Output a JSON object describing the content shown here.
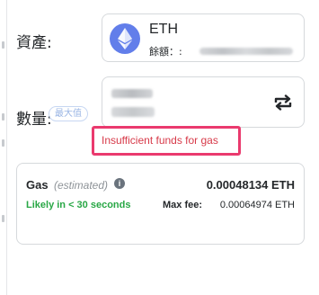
{
  "asset": {
    "label": "資產:",
    "name": "ETH",
    "balance_label": "餘額：:"
  },
  "amount": {
    "label": "數量:",
    "max_button": "最大值"
  },
  "error": {
    "message": "Insufficient funds for gas"
  },
  "gas": {
    "title": "Gas",
    "estimated": "(estimated)",
    "amount": "0.00048134 ETH",
    "likely_time": "Likely in < 30 seconds",
    "max_fee_label": "Max fee:",
    "max_fee_value": "0.00064974 ETH"
  },
  "colors": {
    "eth_icon": "#627eea",
    "error_border": "#ea3a6e",
    "error_text": "#d73a49",
    "likely_green": "#28a745"
  },
  "icons": {
    "asset": "ethereum-icon",
    "swap": "swap-arrows-icon",
    "info": "info-icon"
  }
}
